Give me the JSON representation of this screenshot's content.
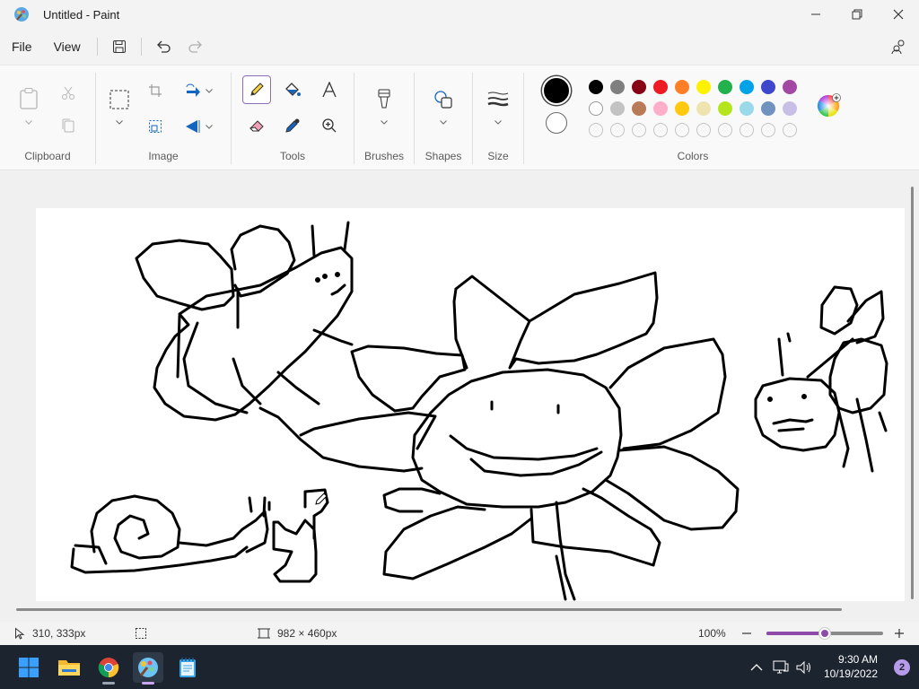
{
  "window": {
    "title": "Untitled - Paint"
  },
  "menu": {
    "file": "File",
    "view": "View"
  },
  "ribbon": {
    "groups": {
      "clipboard": "Clipboard",
      "image": "Image",
      "tools": "Tools",
      "brushes": "Brushes",
      "shapes": "Shapes",
      "size": "Size",
      "colors": "Colors"
    },
    "selected_tool": "pencil",
    "primary_color": "#000000",
    "secondary_color": "#ffffff",
    "palette_row1": [
      "#000000",
      "#7f7f7f",
      "#880015",
      "#ed1c24",
      "#ff7f27",
      "#fff200",
      "#22b14c",
      "#00a2e8",
      "#3f48cc",
      "#a349a4"
    ],
    "palette_row2": [
      "#ffffff",
      "#c3c3c3",
      "#b97a57",
      "#ffaec9",
      "#ffc90e",
      "#efe4b0",
      "#b5e61d",
      "#99d9ea",
      "#7092be",
      "#c8bfe7"
    ],
    "palette_row3_count": 10
  },
  "status": {
    "cursor_position": "310, 333px",
    "canvas_size": "982 × 460px",
    "zoom": "100%",
    "zoom_level": 0.5
  },
  "taskbar": {
    "time": "9:30 AM",
    "date": "10/19/2022",
    "notifications": "2"
  }
}
